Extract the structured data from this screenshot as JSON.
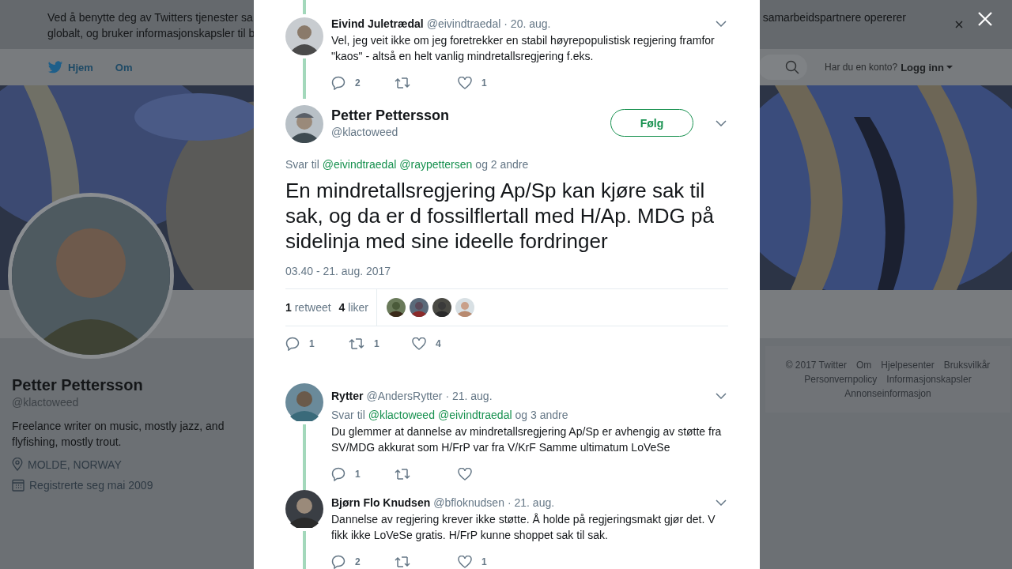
{
  "cookie_banner": {
    "line_1": "Ved å benytte deg av Twitters tjenester sa",
    "line_2": "globalt, og bruker informasjonskapsler til b",
    "right_text": "samarbeidspartnere opererer"
  },
  "nav": {
    "items": [
      {
        "label": "Hjem",
        "kind": "home"
      },
      {
        "label": "Om",
        "kind": "plain"
      }
    ],
    "account_prompt": "Har du en konto?",
    "login": "Logg inn"
  },
  "profile": {
    "name": "Petter Pettersson",
    "handle": "@klactoweed",
    "bio": "Freelance writer on music, mostly jazz, and flyfishing, mostly trout.",
    "location": "MOLDE, NORWAY",
    "joined": "Registrerte seg mai 2009"
  },
  "footer": {
    "links": [
      "© 2017 Twitter",
      "Om",
      "Hjelpesenter",
      "Bruksvilkår",
      "Personvernpolicy",
      "Informasjonskapsler",
      "Annonseinformasjon"
    ]
  },
  "modal": {
    "replies_above": [
      {
        "name": "Eivind Juletrædal",
        "handle": "@eivindtraedal",
        "date": "· 20. aug.",
        "text": "Vel, jeg veit ikke om jeg foretrekker en stabil høyrepopulistisk regjering framfor \"kaos\" - altså en helt vanlig mindretallsregjering f.eks.",
        "replies": "2",
        "likes": "1",
        "thread_above": true,
        "thread_below": true
      }
    ],
    "tweet": {
      "name": "Petter Pettersson",
      "handle": "@klactoweed",
      "follow": "Følg",
      "reply_to": {
        "prefix": "Svar til",
        "mentions": [
          "@eivindtraedal",
          "@raypettersen"
        ],
        "suffix": "og 2 andre"
      },
      "text": "En mindretallsregjering Ap/Sp kan kjøre sak til sak, og da er d fossilflertall med H/Ap. MDG på sidelinja med sine ideelle fordringer",
      "date": "03.40 - 21. aug. 2017",
      "retweet_stat": "**1** retweet",
      "like_stat": "**4** liker",
      "replies": "1",
      "retweets": "1",
      "likes": "4"
    },
    "replies": [
      {
        "name": "Rytter",
        "handle": "@AndersRytter",
        "date": "· 21. aug.",
        "reply_to": {
          "prefix": "Svar til",
          "mentions": [
            "@klactoweed",
            "@eivindtraedal"
          ],
          "suffix": "og 3 andre"
        },
        "text": "Du glemmer at dannelse av mindretallsregjering Ap/Sp er avhengig av støtte fra SV/MDG akkurat som H/FrP var fra V/KrF Samme ultimatum LoVeSe",
        "replies": "1",
        "thread_below": true
      },
      {
        "name": "Bjørn Flo Knudsen",
        "handle": "@bfloknudsen",
        "date": "· 21. aug.",
        "text": "Dannelse av regjering krever ikke støtte. Å holde på regjeringsmakt gjør det. V fikk ikke LoVeSe gratis. H/FrP kunne shoppet sak til sak.",
        "replies": "2",
        "likes": "1",
        "thread_below": true
      }
    ]
  }
}
